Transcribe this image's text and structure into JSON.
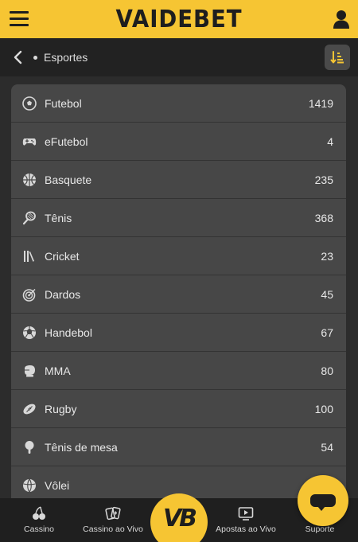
{
  "header": {
    "logo_text": "VAIDEBET",
    "brand_color": "#f6c533"
  },
  "subheader": {
    "breadcrumb": "Esportes"
  },
  "sports": [
    {
      "name": "Futebol",
      "count": "1419",
      "icon": "soccer-ball-icon"
    },
    {
      "name": "eFutebol",
      "count": "4",
      "icon": "gamepad-icon"
    },
    {
      "name": "Basquete",
      "count": "235",
      "icon": "basketball-icon"
    },
    {
      "name": "Tênis",
      "count": "368",
      "icon": "tennis-racket-icon"
    },
    {
      "name": "Cricket",
      "count": "23",
      "icon": "cricket-icon"
    },
    {
      "name": "Dardos",
      "count": "45",
      "icon": "dartboard-icon"
    },
    {
      "name": "Handebol",
      "count": "67",
      "icon": "handball-icon"
    },
    {
      "name": "MMA",
      "count": "80",
      "icon": "boxing-glove-icon"
    },
    {
      "name": "Rugby",
      "count": "100",
      "icon": "rugby-ball-icon"
    },
    {
      "name": "Tênis de mesa",
      "count": "54",
      "icon": "table-tennis-icon"
    },
    {
      "name": "Vôlei",
      "count": "",
      "icon": "volleyball-icon"
    }
  ],
  "bottom_nav": {
    "items": [
      {
        "label": "Cassino",
        "icon": "cherries-icon"
      },
      {
        "label": "Cassino ao Vivo",
        "icon": "cards-icon"
      },
      {
        "label": "Apostas ao Vivo",
        "icon": "play-screen-icon"
      },
      {
        "label": "Suporte",
        "icon": "chat-icon"
      }
    ],
    "center_logo_text": "VB"
  }
}
